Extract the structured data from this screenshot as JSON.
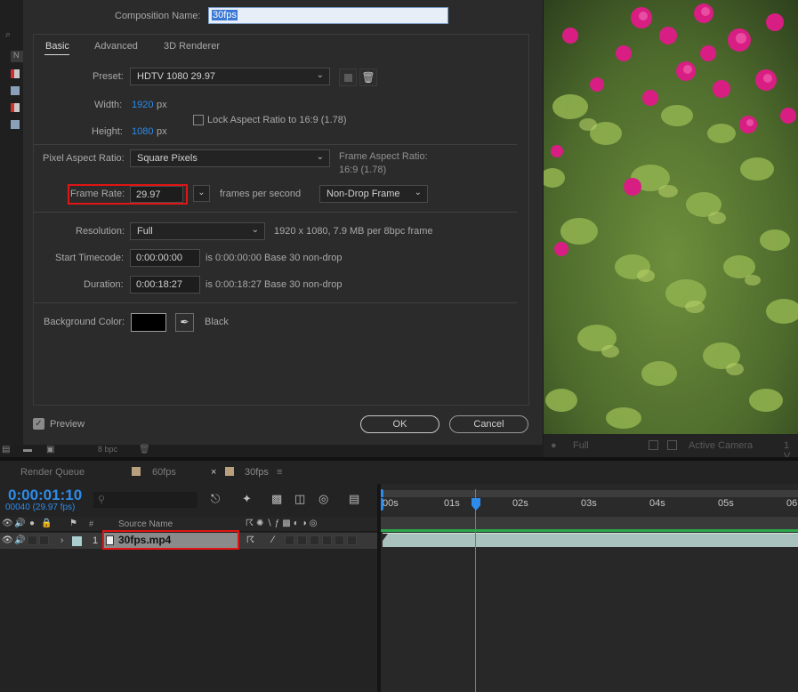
{
  "dialog": {
    "comp_name_label": "Composition Name:",
    "comp_name_value": "30fps",
    "tabs": [
      "Basic",
      "Advanced",
      "3D Renderer"
    ],
    "preset_label": "Preset:",
    "preset_value": "HDTV 1080 29.97",
    "width_label": "Width:",
    "width_value": "1920",
    "width_unit": "px",
    "height_label": "Height:",
    "height_value": "1080",
    "height_unit": "px",
    "lock_aspect_label": "Lock Aspect Ratio to 16:9 (1.78)",
    "par_label": "Pixel Aspect Ratio:",
    "par_value": "Square Pixels",
    "frame_aspect_label": "Frame Aspect Ratio:",
    "frame_aspect_value": "16:9 (1.78)",
    "frame_rate_label": "Frame Rate:",
    "frame_rate_value": "29.97",
    "fps_label": "frames per second",
    "drop_frame_value": "Non-Drop Frame",
    "resolution_label": "Resolution:",
    "resolution_value": "Full",
    "resolution_info": "1920 x 1080, 7.9 MB per 8bpc frame",
    "start_tc_label": "Start Timecode:",
    "start_tc_value": "0:00:00:00",
    "start_tc_info": "is 0:00:00:00  Base 30  non-drop",
    "duration_label": "Duration:",
    "duration_value": "0:00:18:27",
    "duration_info": "is 0:00:18:27  Base 30  non-drop",
    "bg_color_label": "Background Color:",
    "bg_color_name": "Black",
    "bg_color_hex": "#000000",
    "preview_label": "Preview",
    "ok_label": "OK",
    "cancel_label": "Cancel"
  },
  "viewer_bar": {
    "resolution": "Full",
    "camera": "Active Camera",
    "views": "1 V"
  },
  "bottom_strip": {
    "bpc": "8 bpc"
  },
  "timeline": {
    "tabs": [
      "Render Queue",
      "60fps",
      "30fps"
    ],
    "current_time": "0:00:01:10",
    "current_frame": "00040 (29.97 fps)",
    "search_placeholder": "",
    "col_hash": "#",
    "col_source": "Source Name",
    "layer_number": "1",
    "layer_name": "30fps.mp4",
    "ruler_labels": [
      ":00s",
      "01s",
      "02s",
      "03s",
      "04s",
      "05s",
      "06"
    ]
  },
  "colors": {
    "accent_blue": "#2d8ceb",
    "highlight_red": "#e01515",
    "clip_teal": "#a9c2bd",
    "work_area_green": "#2aa84a"
  }
}
